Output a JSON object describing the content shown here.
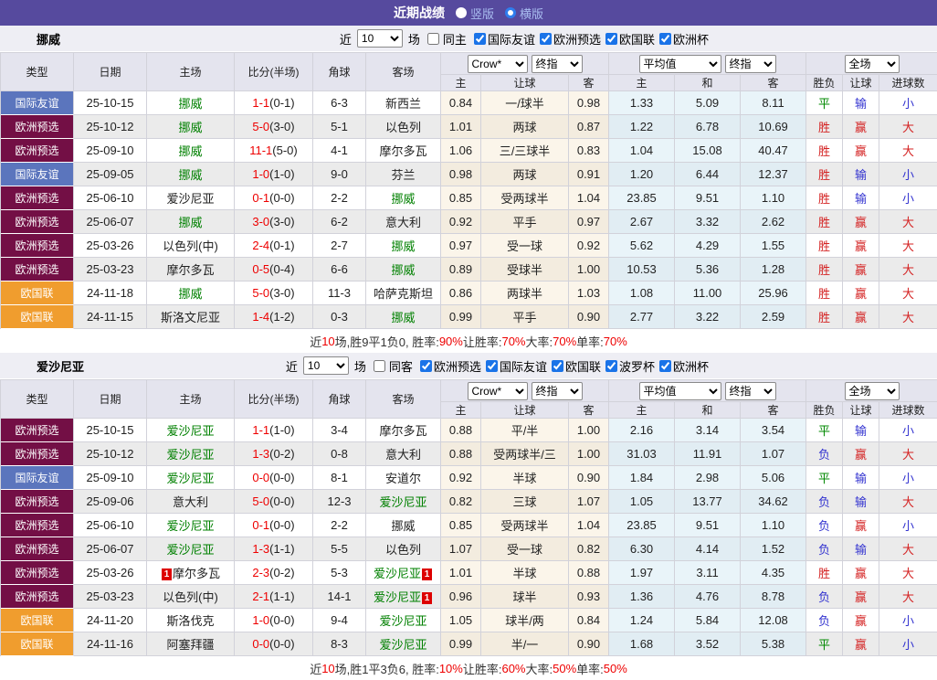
{
  "colors": {
    "accent_purple": "#564a9e",
    "badge": {
      "国际友谊": "#5b75bd",
      "欧洲预选": "#730f45",
      "欧国联": "#f09d2e"
    },
    "team_highlight": "#008000",
    "score_red": "#ee0000",
    "result": {
      "胜": "#d42222",
      "平": "#008800",
      "负": "#3434d0",
      "赢": "#d42222",
      "输": "#3434d0",
      "大": "#d42222",
      "小": "#3434d0"
    }
  },
  "titlebar": {
    "title": "近期战绩",
    "radios": [
      {
        "label": "竖版",
        "selected": false
      },
      {
        "label": "横版",
        "selected": true
      }
    ]
  },
  "tables": [
    {
      "team": "挪威",
      "filter": {
        "near_label": "近",
        "count": "10",
        "games_label": "场",
        "same_label": "同主",
        "leagues": [
          "国际友谊",
          "欧洲预选",
          "欧国联",
          "欧洲杯"
        ]
      },
      "columns": [
        "类型",
        "日期",
        "主场",
        "比分(半场)",
        "角球",
        "客场"
      ],
      "selects": {
        "odds_source": "Crow*",
        "odds_final": "终指",
        "avg": "平均值",
        "avg_final": "终指",
        "scope": "全场"
      },
      "sub_columns": [
        "主",
        "让球",
        "客",
        "主",
        "和",
        "客",
        "胜负",
        "让球",
        "进球数"
      ],
      "rows": [
        {
          "type": "国际友谊",
          "date": "25-10-15",
          "home": "挪威",
          "home_hl": true,
          "score": "1-1",
          "half": "(0-1)",
          "corners": "6-3",
          "away": "新西兰",
          "away_hl": false,
          "odds": [
            "0.84",
            "一/球半",
            "0.98"
          ],
          "avg": [
            "1.33",
            "5.09",
            "8.11"
          ],
          "results": [
            "平",
            "输",
            "小"
          ]
        },
        {
          "type": "欧洲预选",
          "date": "25-10-12",
          "home": "挪威",
          "home_hl": true,
          "score": "5-0",
          "half": "(3-0)",
          "corners": "5-1",
          "away": "以色列",
          "away_hl": false,
          "odds": [
            "1.01",
            "两球",
            "0.87"
          ],
          "avg": [
            "1.22",
            "6.78",
            "10.69"
          ],
          "results": [
            "胜",
            "赢",
            "大"
          ]
        },
        {
          "type": "欧洲预选",
          "date": "25-09-10",
          "home": "挪威",
          "home_hl": true,
          "score": "11-1",
          "half": "(5-0)",
          "corners": "4-1",
          "away": "摩尔多瓦",
          "away_hl": false,
          "odds": [
            "1.06",
            "三/三球半",
            "0.83"
          ],
          "avg": [
            "1.04",
            "15.08",
            "40.47"
          ],
          "results": [
            "胜",
            "赢",
            "大"
          ]
        },
        {
          "type": "国际友谊",
          "date": "25-09-05",
          "home": "挪威",
          "home_hl": true,
          "score": "1-0",
          "half": "(1-0)",
          "corners": "9-0",
          "away": "芬兰",
          "away_hl": false,
          "odds": [
            "0.98",
            "两球",
            "0.91"
          ],
          "avg": [
            "1.20",
            "6.44",
            "12.37"
          ],
          "results": [
            "胜",
            "输",
            "小"
          ]
        },
        {
          "type": "欧洲预选",
          "date": "25-06-10",
          "home": "爱沙尼亚",
          "home_hl": false,
          "score": "0-1",
          "half": "(0-0)",
          "corners": "2-2",
          "away": "挪威",
          "away_hl": true,
          "odds": [
            "0.85",
            "受两球半",
            "1.04"
          ],
          "avg": [
            "23.85",
            "9.51",
            "1.10"
          ],
          "results": [
            "胜",
            "输",
            "小"
          ]
        },
        {
          "type": "欧洲预选",
          "date": "25-06-07",
          "home": "挪威",
          "home_hl": true,
          "score": "3-0",
          "half": "(3-0)",
          "corners": "6-2",
          "away": "意大利",
          "away_hl": false,
          "odds": [
            "0.92",
            "平手",
            "0.97"
          ],
          "avg": [
            "2.67",
            "3.32",
            "2.62"
          ],
          "results": [
            "胜",
            "赢",
            "大"
          ]
        },
        {
          "type": "欧洲预选",
          "date": "25-03-26",
          "home": "以色列(中)",
          "home_hl": false,
          "score": "2-4",
          "half": "(0-1)",
          "corners": "2-7",
          "away": "挪威",
          "away_hl": true,
          "odds": [
            "0.97",
            "受一球",
            "0.92"
          ],
          "avg": [
            "5.62",
            "4.29",
            "1.55"
          ],
          "results": [
            "胜",
            "赢",
            "大"
          ]
        },
        {
          "type": "欧洲预选",
          "date": "25-03-23",
          "home": "摩尔多瓦",
          "home_hl": false,
          "score": "0-5",
          "half": "(0-4)",
          "corners": "6-6",
          "away": "挪威",
          "away_hl": true,
          "odds": [
            "0.89",
            "受球半",
            "1.00"
          ],
          "avg": [
            "10.53",
            "5.36",
            "1.28"
          ],
          "results": [
            "胜",
            "赢",
            "大"
          ]
        },
        {
          "type": "欧国联",
          "date": "24-11-18",
          "home": "挪威",
          "home_hl": true,
          "score": "5-0",
          "half": "(3-0)",
          "corners": "11-3",
          "away": "哈萨克斯坦",
          "away_hl": false,
          "odds": [
            "0.86",
            "两球半",
            "1.03"
          ],
          "avg": [
            "1.08",
            "11.00",
            "25.96"
          ],
          "results": [
            "胜",
            "赢",
            "大"
          ]
        },
        {
          "type": "欧国联",
          "date": "24-11-15",
          "home": "斯洛文尼亚",
          "home_hl": false,
          "score": "1-4",
          "half": "(1-2)",
          "corners": "0-3",
          "away": "挪威",
          "away_hl": true,
          "odds": [
            "0.99",
            "平手",
            "0.90"
          ],
          "avg": [
            "2.77",
            "3.22",
            "2.59"
          ],
          "results": [
            "胜",
            "赢",
            "大"
          ]
        }
      ],
      "summary": [
        {
          "t": "近"
        },
        {
          "t": "10",
          "red": true
        },
        {
          "t": "场,胜9平1负0, 胜率:"
        },
        {
          "t": "90%",
          "red": true
        },
        {
          "t": " 让胜率:"
        },
        {
          "t": "70%",
          "red": true
        },
        {
          "t": " 大率:"
        },
        {
          "t": "70%",
          "red": true
        },
        {
          "t": " 单率:"
        },
        {
          "t": "70%",
          "red": true
        }
      ]
    },
    {
      "team": "爱沙尼亚",
      "filter": {
        "near_label": "近",
        "count": "10",
        "games_label": "场",
        "same_label": "同客",
        "leagues": [
          "欧洲预选",
          "国际友谊",
          "欧国联",
          "波罗杯",
          "欧洲杯"
        ]
      },
      "columns": [
        "类型",
        "日期",
        "主场",
        "比分(半场)",
        "角球",
        "客场"
      ],
      "selects": {
        "odds_source": "Crow*",
        "odds_final": "终指",
        "avg": "平均值",
        "avg_final": "终指",
        "scope": "全场"
      },
      "sub_columns": [
        "主",
        "让球",
        "客",
        "主",
        "和",
        "客",
        "胜负",
        "让球",
        "进球数"
      ],
      "rows": [
        {
          "type": "欧洲预选",
          "date": "25-10-15",
          "home": "爱沙尼亚",
          "home_hl": true,
          "score": "1-1",
          "half": "(1-0)",
          "corners": "3-4",
          "away": "摩尔多瓦",
          "away_hl": false,
          "odds": [
            "0.88",
            "平/半",
            "1.00"
          ],
          "avg": [
            "2.16",
            "3.14",
            "3.54"
          ],
          "results": [
            "平",
            "输",
            "小"
          ]
        },
        {
          "type": "欧洲预选",
          "date": "25-10-12",
          "home": "爱沙尼亚",
          "home_hl": true,
          "score": "1-3",
          "half": "(0-2)",
          "corners": "0-8",
          "away": "意大利",
          "away_hl": false,
          "odds": [
            "0.88",
            "受两球半/三",
            "1.00"
          ],
          "avg": [
            "31.03",
            "11.91",
            "1.07"
          ],
          "results": [
            "负",
            "赢",
            "大"
          ]
        },
        {
          "type": "国际友谊",
          "date": "25-09-10",
          "home": "爱沙尼亚",
          "home_hl": true,
          "score": "0-0",
          "half": "(0-0)",
          "corners": "8-1",
          "away": "安道尔",
          "away_hl": false,
          "odds": [
            "0.92",
            "半球",
            "0.90"
          ],
          "avg": [
            "1.84",
            "2.98",
            "5.06"
          ],
          "results": [
            "平",
            "输",
            "小"
          ]
        },
        {
          "type": "欧洲预选",
          "date": "25-09-06",
          "home": "意大利",
          "home_hl": false,
          "score": "5-0",
          "half": "(0-0)",
          "corners": "12-3",
          "away": "爱沙尼亚",
          "away_hl": true,
          "odds": [
            "0.82",
            "三球",
            "1.07"
          ],
          "avg": [
            "1.05",
            "13.77",
            "34.62"
          ],
          "results": [
            "负",
            "输",
            "大"
          ]
        },
        {
          "type": "欧洲预选",
          "date": "25-06-10",
          "home": "爱沙尼亚",
          "home_hl": true,
          "score": "0-1",
          "half": "(0-0)",
          "corners": "2-2",
          "away": "挪威",
          "away_hl": false,
          "odds": [
            "0.85",
            "受两球半",
            "1.04"
          ],
          "avg": [
            "23.85",
            "9.51",
            "1.10"
          ],
          "results": [
            "负",
            "赢",
            "小"
          ]
        },
        {
          "type": "欧洲预选",
          "date": "25-06-07",
          "home": "爱沙尼亚",
          "home_hl": true,
          "score": "1-3",
          "half": "(1-1)",
          "corners": "5-5",
          "away": "以色列",
          "away_hl": false,
          "odds": [
            "1.07",
            "受一球",
            "0.82"
          ],
          "avg": [
            "6.30",
            "4.14",
            "1.52"
          ],
          "results": [
            "负",
            "输",
            "大"
          ]
        },
        {
          "type": "欧洲预选",
          "date": "25-03-26",
          "home": "摩尔多瓦",
          "home_hl": false,
          "home_card_before": "1",
          "score": "2-3",
          "half": "(0-2)",
          "corners": "5-3",
          "away": "爱沙尼亚",
          "away_hl": true,
          "away_card_after": "1",
          "odds": [
            "1.01",
            "半球",
            "0.88"
          ],
          "avg": [
            "1.97",
            "3.11",
            "4.35"
          ],
          "results": [
            "胜",
            "赢",
            "大"
          ]
        },
        {
          "type": "欧洲预选",
          "date": "25-03-23",
          "home": "以色列(中)",
          "home_hl": false,
          "score": "2-1",
          "half": "(1-1)",
          "corners": "14-1",
          "away": "爱沙尼亚",
          "away_hl": true,
          "away_card_after": "1",
          "odds": [
            "0.96",
            "球半",
            "0.93"
          ],
          "avg": [
            "1.36",
            "4.76",
            "8.78"
          ],
          "results": [
            "负",
            "赢",
            "大"
          ]
        },
        {
          "type": "欧国联",
          "date": "24-11-20",
          "home": "斯洛伐克",
          "home_hl": false,
          "score": "1-0",
          "half": "(0-0)",
          "corners": "9-4",
          "away": "爱沙尼亚",
          "away_hl": true,
          "odds": [
            "1.05",
            "球半/两",
            "0.84"
          ],
          "avg": [
            "1.24",
            "5.84",
            "12.08"
          ],
          "results": [
            "负",
            "赢",
            "小"
          ]
        },
        {
          "type": "欧国联",
          "date": "24-11-16",
          "home": "阿塞拜疆",
          "home_hl": false,
          "score": "0-0",
          "half": "(0-0)",
          "corners": "8-3",
          "away": "爱沙尼亚",
          "away_hl": true,
          "odds": [
            "0.99",
            "半/一",
            "0.90"
          ],
          "avg": [
            "1.68",
            "3.52",
            "5.38"
          ],
          "results": [
            "平",
            "赢",
            "小"
          ]
        }
      ],
      "summary": [
        {
          "t": "近"
        },
        {
          "t": "10",
          "red": true
        },
        {
          "t": "场,胜1平3负6, 胜率:"
        },
        {
          "t": "10%",
          "red": true
        },
        {
          "t": " 让胜率:"
        },
        {
          "t": "60%",
          "red": true
        },
        {
          "t": " 大率:"
        },
        {
          "t": "50%",
          "red": true
        },
        {
          "t": " 单率:"
        },
        {
          "t": "50%",
          "red": true
        }
      ]
    }
  ]
}
